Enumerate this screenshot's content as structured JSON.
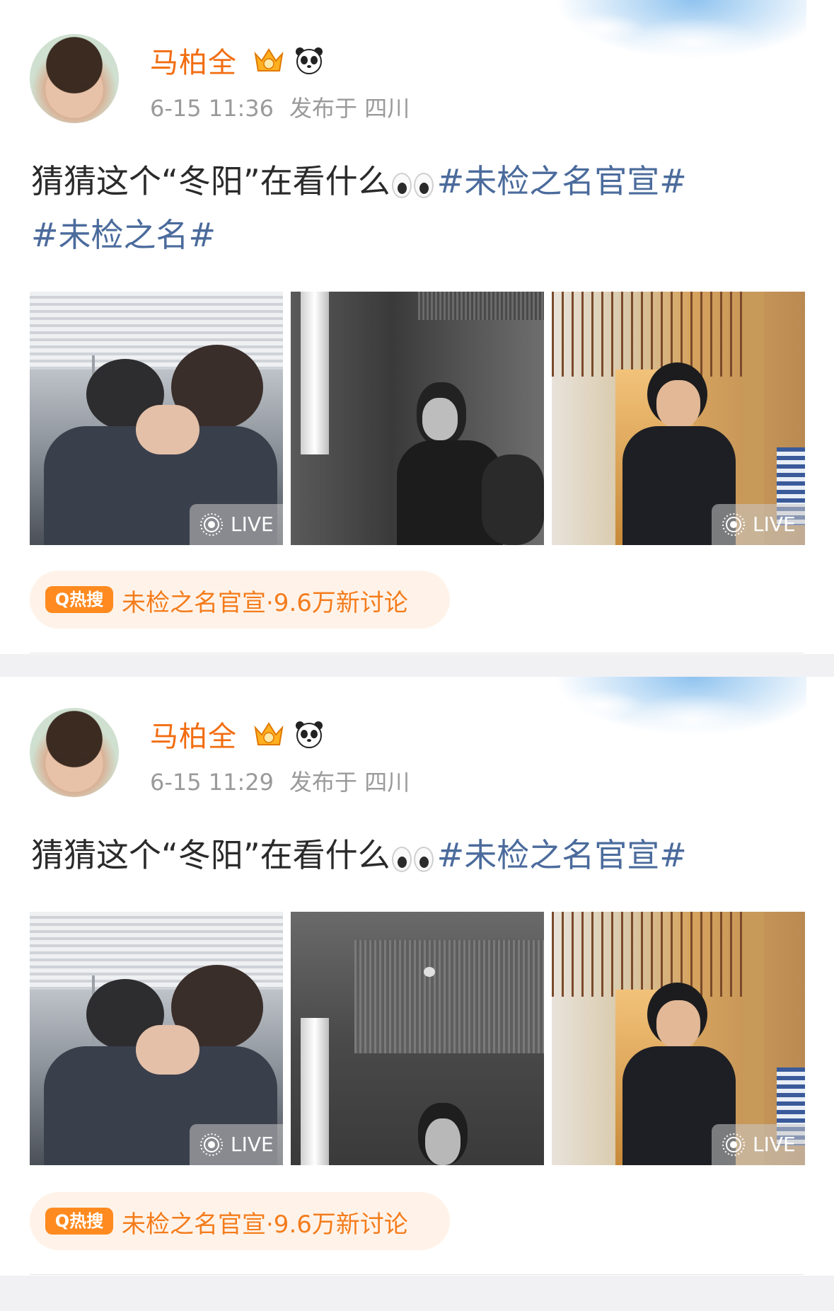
{
  "posts": [
    {
      "username": "马柏全",
      "time": "6-15 11:36",
      "location": "发布于 四川",
      "text_plain": "猜猜这个“冬阳”在看什么",
      "topic_1": "#未检之名官宣#",
      "topic_2": "#未检之名#",
      "photos": [
        {
          "live": "LIVE"
        },
        {
          "live": ""
        },
        {
          "live": "LIVE"
        }
      ],
      "hot_badge": "Q热搜",
      "hot_text": "未检之名官宣·9.6万新讨论"
    },
    {
      "username": "马柏全",
      "time": "6-15 11:29",
      "location": "发布于 四川",
      "text_plain": "猜猜这个“冬阳”在看什么",
      "topic_1": "#未检之名官宣#",
      "photos": [
        {
          "live": "LIVE"
        },
        {
          "live": ""
        },
        {
          "live": "LIVE"
        }
      ],
      "hot_badge": "Q热搜",
      "hot_text": "未检之名官宣·9.6万新讨论"
    }
  ],
  "colors": {
    "username": "#f26d11",
    "topic": "#4b6b9c",
    "hot_bg": "#fff3e9",
    "hot_badge": "#ff8a1f"
  },
  "icons": [
    "vip-crown-icon",
    "panda-icon",
    "eyes-emoji",
    "live-photo-icon",
    "hot-search-icon"
  ]
}
